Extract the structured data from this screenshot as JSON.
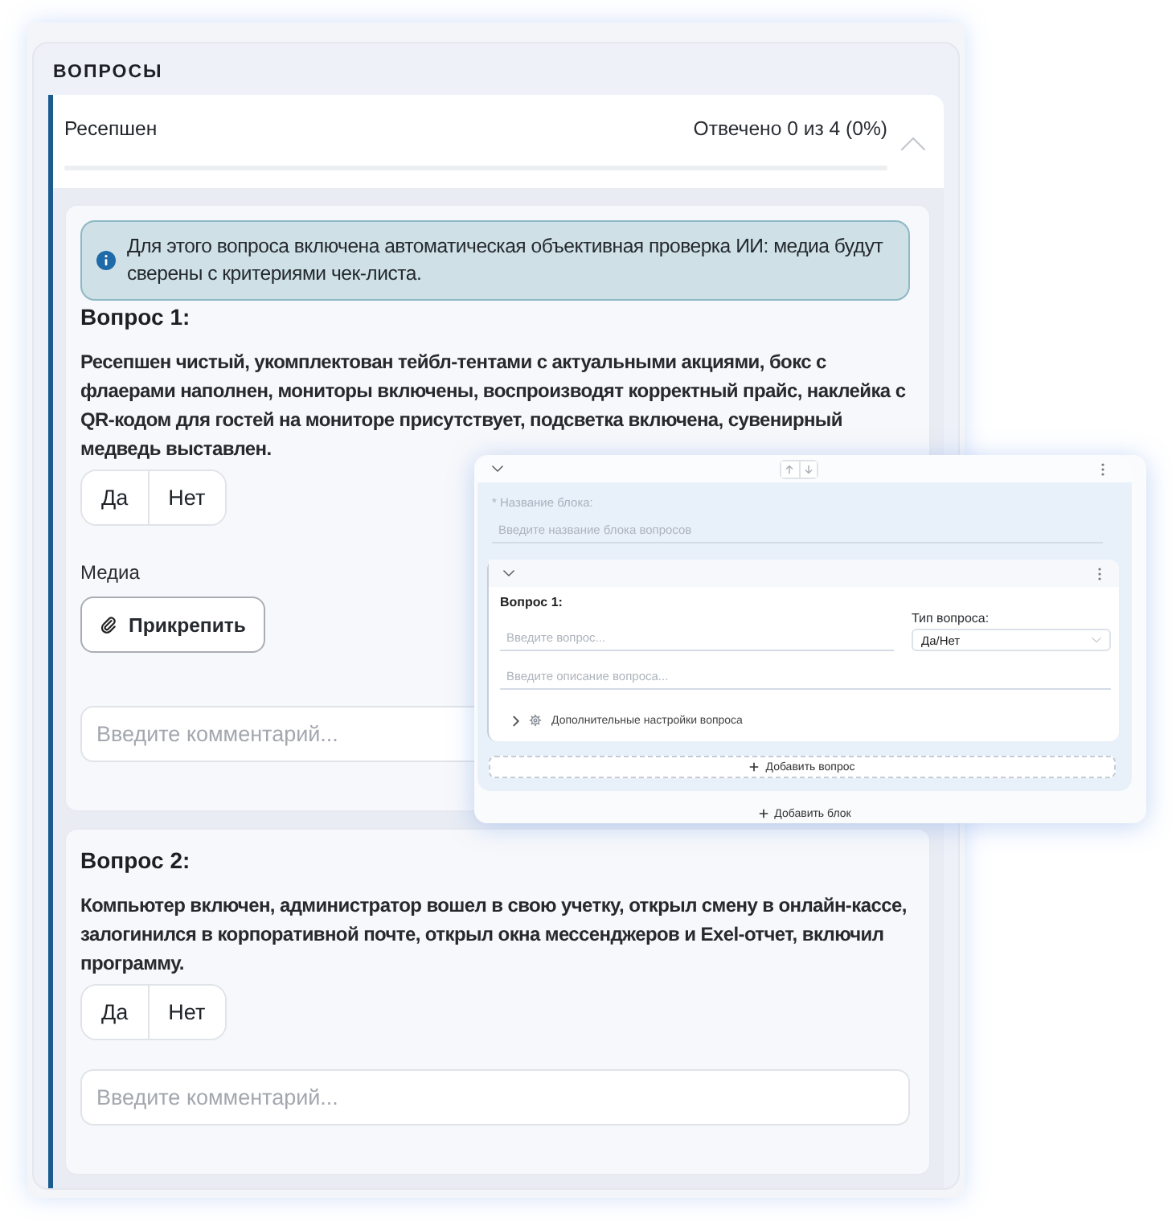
{
  "section_title": "ВОПРОСЫ",
  "block": {
    "title": "Ресепшен",
    "progress_text": "Отвечено 0 из 4 (0%)",
    "level": 0,
    "expanded": true,
    "questions": [
      {
        "info": "Для этого вопроса включена автоматическая объективная проверка ИИ: медиа будут сверены с критериями чек-листа.",
        "title": "Вопрос 1:",
        "text": "Ресепшен чистый, укомплектован тейбл-тентами с актуальными акциями, бокс с флаерами наполнен, мониторы включены, воспроизводят корректный прайс, наклейка с QR-кодом для гостей на мониторе присутствует, подсветка включена, сувенирный медведь выставлен.",
        "answers": [
          {
            "label": "Да",
            "selected": false
          },
          {
            "label": "Нет",
            "selected": false
          }
        ],
        "media_label": "Медиа",
        "attach_button": "Прикрепить",
        "comment_placeholder": "Введите комментарий..."
      },
      {
        "title": "Вопрос 2:",
        "text": "Компьютер включен, администратор вошел в свою учетку, открыл смену в онлайн-кассе, залогинился в корпоративной почте, открыл окна мессенджеров и Exel-отчет, включил программу.",
        "answers": [
          {
            "label": "Да",
            "selected": false
          },
          {
            "label": "Нет",
            "selected": false
          }
        ],
        "comment_placeholder": "Введите комментарий..."
      }
    ]
  },
  "editor": {
    "block_expanded": true,
    "block_name_label": "* Название блока:",
    "block_name_placeholder": "Введите название блока вопросов",
    "questions": [
      {
        "expanded": true,
        "title": "Вопрос 1:",
        "question_placeholder": "Введите вопрос...",
        "type_label": "Тип вопроса:",
        "type_value": "Да/Нет",
        "description_placeholder": "Введите описание вопроса...",
        "advanced_label": "Дополнительные настройки вопроса",
        "advanced_expanded": false
      }
    ],
    "add_question_button": "Добавить вопрос",
    "add_block_button": "Добавить блок"
  }
}
